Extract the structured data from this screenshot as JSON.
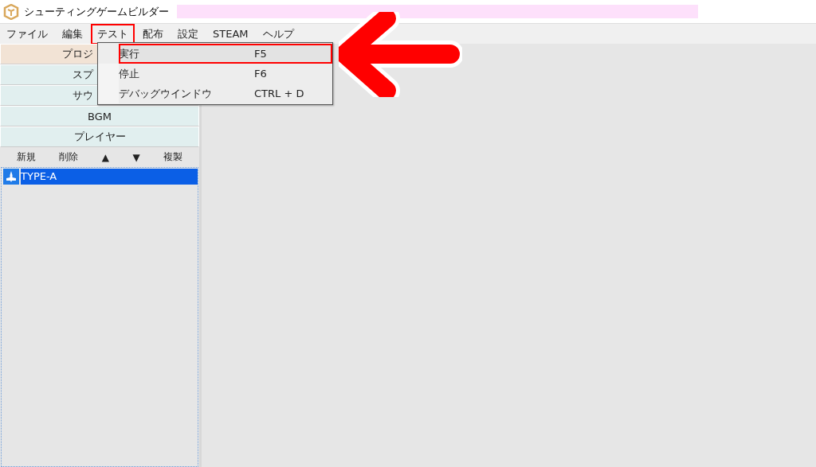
{
  "window": {
    "title": "シューティングゲームビルダー"
  },
  "menus": [
    {
      "label": "ファイル",
      "selected": false
    },
    {
      "label": "編集",
      "selected": false
    },
    {
      "label": "テスト",
      "selected": true
    },
    {
      "label": "配布",
      "selected": false
    },
    {
      "label": "設定",
      "selected": false
    },
    {
      "label": "STEAM",
      "selected": false
    },
    {
      "label": "ヘルプ",
      "selected": false
    }
  ],
  "dropdown": [
    {
      "label": "実行",
      "shortcut": "F5",
      "selected": true
    },
    {
      "label": "停止",
      "shortcut": "F6",
      "selected": false
    },
    {
      "label": "デバッグウインドウ",
      "shortcut": "CTRL + D",
      "selected": false
    }
  ],
  "sidebar": {
    "sections": [
      {
        "label": "プロジ",
        "selected": true,
        "covered": true
      },
      {
        "label": "スプ",
        "selected": false,
        "covered": true
      },
      {
        "label": "サウ",
        "selected": false,
        "covered": true
      },
      {
        "label": "BGM",
        "selected": false,
        "covered": false
      },
      {
        "label": "プレイヤー",
        "selected": false,
        "covered": false
      }
    ],
    "toolbar": [
      "新規",
      "削除",
      "▲",
      "▼",
      "複製"
    ],
    "items": [
      {
        "label": "TYPE-A",
        "selected": true
      }
    ]
  }
}
